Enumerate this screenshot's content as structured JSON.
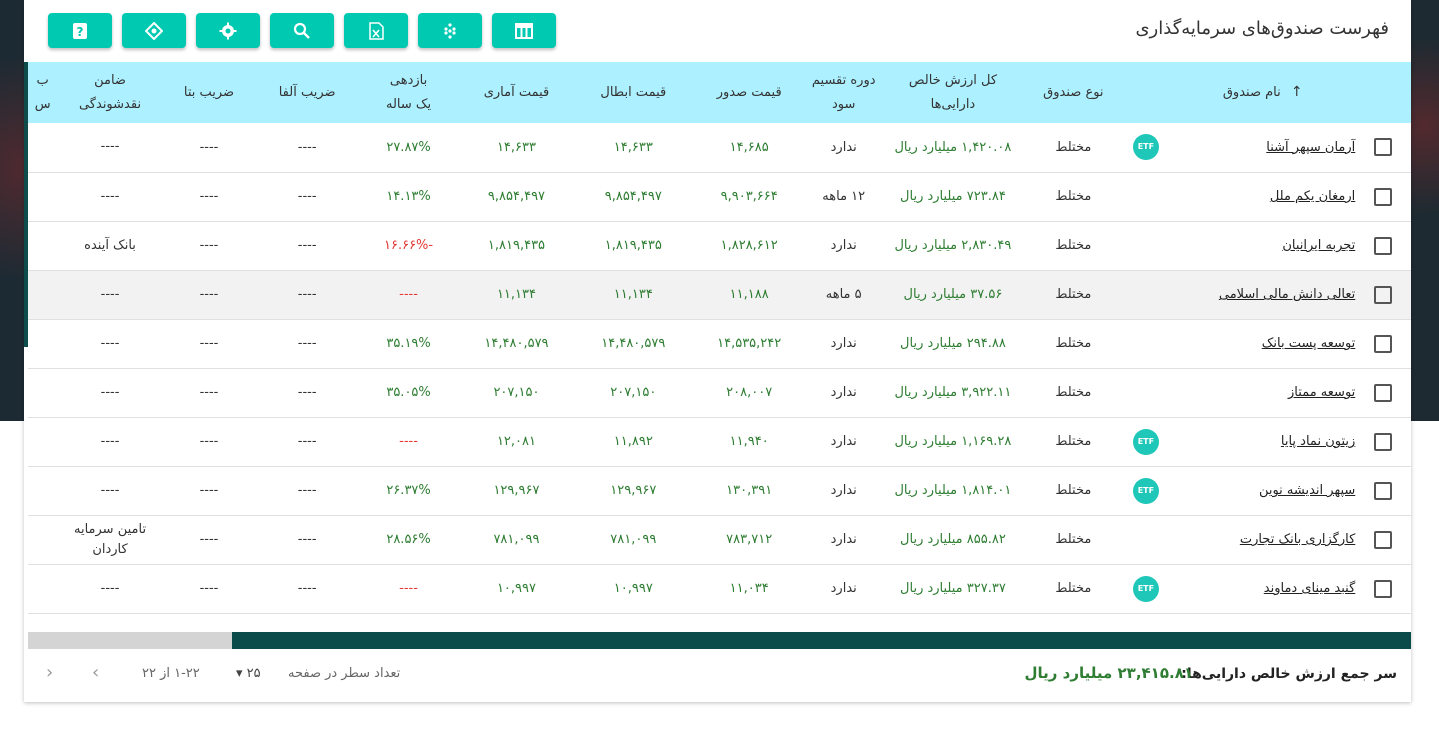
{
  "page": {
    "title": "فهرست صندوق‌های سرمایه‌گذاری"
  },
  "toolbar": {
    "buttons": [
      {
        "name": "help",
        "label": "?"
      },
      {
        "name": "reset",
        "label": ""
      },
      {
        "name": "settings",
        "label": ""
      },
      {
        "name": "search",
        "label": ""
      },
      {
        "name": "excel",
        "label": ""
      },
      {
        "name": "density",
        "label": ""
      },
      {
        "name": "columns",
        "label": ""
      }
    ]
  },
  "table": {
    "headers": {
      "name": "نام صندوق",
      "type": "نوع صندوق",
      "nav": "کل ارزش خالص داراییها",
      "nav_line1": "کل ارزش خالص",
      "nav_line2": "دارایی‌ها",
      "div_line1": "دوره تقسیم",
      "div_line2": "سود",
      "issue": "قیمت صدور",
      "cancel": "قیمت ابطال",
      "stat": "قیمت آماری",
      "ret_line1": "بازدهی",
      "ret_line2": "یک ساله",
      "alpha": "ضریب آلفا",
      "beta": "ضریب بتا",
      "guar_line1": "ضامن",
      "guar_line2": "نقدشوندگی",
      "extra1": "ب",
      "extra2": "س"
    },
    "rows": [
      {
        "name": "آرمان سپهر آشنا",
        "etf": "ETF",
        "type": "مختلط",
        "nav": "۱,۴۲۰.۰۸ میلیارد ریال",
        "div": "ندارد",
        "issue": "۱۴,۶۸۵",
        "cancel": "۱۴,۶۳۳",
        "stat": "۱۴,۶۳۳",
        "ret": "۲۷.۸۷%",
        "alpha": "----",
        "beta": "----",
        "guar": "----"
      },
      {
        "name": "ارمغان یکم ملل",
        "etf": "",
        "type": "مختلط",
        "nav": "۷۲۳.۸۴ میلیارد ریال",
        "div": "۱۲ ماهه",
        "issue": "۹,۹۰۳,۶۶۴",
        "cancel": "۹,۸۵۴,۴۹۷",
        "stat": "۹,۸۵۴,۴۹۷",
        "ret": "۱۴.۱۳%",
        "alpha": "----",
        "beta": "----",
        "guar": "----"
      },
      {
        "name": "تجربه ایرانیان",
        "etf": "",
        "type": "مختلط",
        "nav": "۲,۸۳۰.۴۹ میلیارد ریال",
        "div": "ندارد",
        "issue": "۱,۸۲۸,۶۱۲",
        "cancel": "۱,۸۱۹,۴۳۵",
        "stat": "۱,۸۱۹,۴۳۵",
        "ret": "-۱۶.۶۶%",
        "alpha": "----",
        "beta": "----",
        "guar": "بانک آینده"
      },
      {
        "name": "تعالی دانش مالی اسلامی",
        "etf": "",
        "type": "مختلط",
        "nav": "۳۷.۵۶ میلیارد ریال",
        "div": "۵ ماهه",
        "issue": "۱۱,۱۸۸",
        "cancel": "۱۱,۱۳۴",
        "stat": "۱۱,۱۳۴",
        "ret": "----",
        "alpha": "----",
        "beta": "----",
        "guar": "----"
      },
      {
        "name": "توسعه پست بانک",
        "etf": "",
        "type": "مختلط",
        "nav": "۲۹۴.۸۸ میلیارد ریال",
        "div": "ندارد",
        "issue": "۱۴,۵۳۵,۲۴۲",
        "cancel": "۱۴,۴۸۰,۵۷۹",
        "stat": "۱۴,۴۸۰,۵۷۹",
        "ret": "۳۵.۱۹%",
        "alpha": "----",
        "beta": "----",
        "guar": "----"
      },
      {
        "name": "توسعه ممتاز",
        "etf": "",
        "type": "مختلط",
        "nav": "۳,۹۲۲.۱۱ میلیارد ریال",
        "div": "ندارد",
        "issue": "۲۰۸,۰۰۷",
        "cancel": "۲۰۷,۱۵۰",
        "stat": "۲۰۷,۱۵۰",
        "ret": "۳۵.۰۵%",
        "alpha": "----",
        "beta": "----",
        "guar": "----"
      },
      {
        "name": "زیتون نماد پایا",
        "etf": "ETF",
        "type": "مختلط",
        "nav": "۱,۱۶۹.۲۸ میلیارد ریال",
        "div": "ندارد",
        "issue": "۱۱,۹۴۰",
        "cancel": "۱۱,۸۹۲",
        "stat": "۱۲,۰۸۱",
        "ret": "----",
        "alpha": "----",
        "beta": "----",
        "guar": "----"
      },
      {
        "name": "سپهر اندیشه نوین",
        "etf": "ETF",
        "type": "مختلط",
        "nav": "۱,۸۱۴.۰۱ میلیارد ریال",
        "div": "ندارد",
        "issue": "۱۳۰,۳۹۱",
        "cancel": "۱۲۹,۹۶۷",
        "stat": "۱۲۹,۹۶۷",
        "ret": "۲۶.۳۷%",
        "alpha": "----",
        "beta": "----",
        "guar": "----"
      },
      {
        "name": "کارگزاری بانک تجارت",
        "etf": "",
        "type": "مختلط",
        "nav": "۸۵۵.۸۲ میلیارد ریال",
        "div": "ندارد",
        "issue": "۷۸۳,۷۱۲",
        "cancel": "۷۸۱,۰۹۹",
        "stat": "۷۸۱,۰۹۹",
        "ret": "۲۸.۵۶%",
        "alpha": "----",
        "beta": "----",
        "guar": "تامین سرمایه کاردان"
      },
      {
        "name": "گنبد مینای دماوند",
        "etf": "ETF",
        "type": "مختلط",
        "nav": "۳۲۷.۳۷ میلیارد ریال",
        "div": "ندارد",
        "issue": "۱۱,۰۳۴",
        "cancel": "۱۰,۹۹۷",
        "stat": "۱۰,۹۹۷",
        "ret": "----",
        "alpha": "----",
        "beta": "----",
        "guar": "----"
      }
    ]
  },
  "footer": {
    "total_label": "سر جمع ارزش خالص دارایی‌ها:",
    "total_value": "۲۳,۴۱۵.۸۱ میلیارد ریال",
    "rows_per_page_label": "تعداد سطر در صفحه",
    "rows_per_page_value": "۲۵",
    "page_info": "۱-۲۲ از ۲۲"
  },
  "colors": {
    "accent": "#00c9b1",
    "header_bg": "#adf0ff",
    "positive": "#2e7d32",
    "negative": "#e53935",
    "scroll_thumb": "#0b4b4a"
  }
}
